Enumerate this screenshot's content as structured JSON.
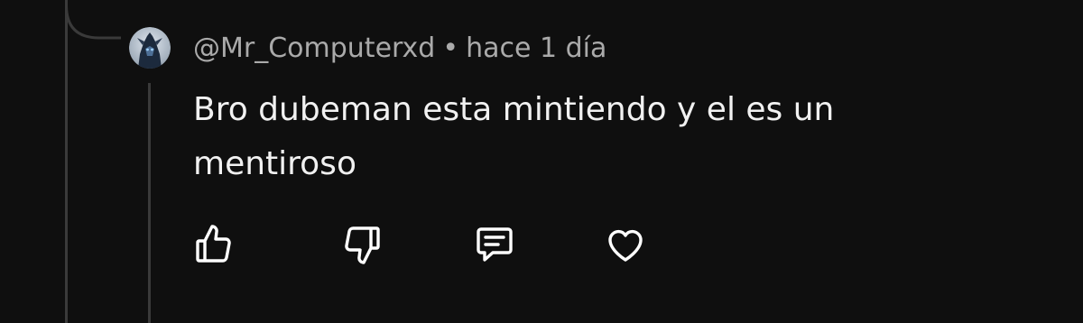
{
  "comment": {
    "author": "@Mr_Computerxd",
    "separator": "•",
    "timestamp": "hace 1 día",
    "text": "Bro dubeman esta mintiendo y el es un mentiroso"
  },
  "actions": [
    {
      "icon": "thumbs-up-icon"
    },
    {
      "icon": "thumbs-down-icon"
    },
    {
      "icon": "comment-icon"
    },
    {
      "icon": "heart-icon"
    }
  ],
  "colors": {
    "background": "#0f0f0f",
    "text_primary": "#f1f1f1",
    "text_secondary": "#aaaaaa",
    "thread_line": "#3a3a3a"
  }
}
